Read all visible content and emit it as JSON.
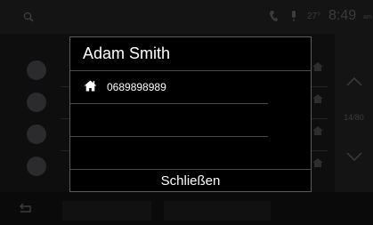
{
  "status": {
    "temperature": "27°",
    "time": "8:49",
    "ampm": "am"
  },
  "list": {
    "counter": "14/80"
  },
  "dialog": {
    "title": "Adam Smith",
    "phone_type_icon": "home-icon",
    "number": "0689898989",
    "close_label": "Schließen"
  },
  "colors": {
    "dialog_border": "#5a5a5c",
    "text": "#ffffff",
    "dim_text": "#3c3c3e"
  }
}
